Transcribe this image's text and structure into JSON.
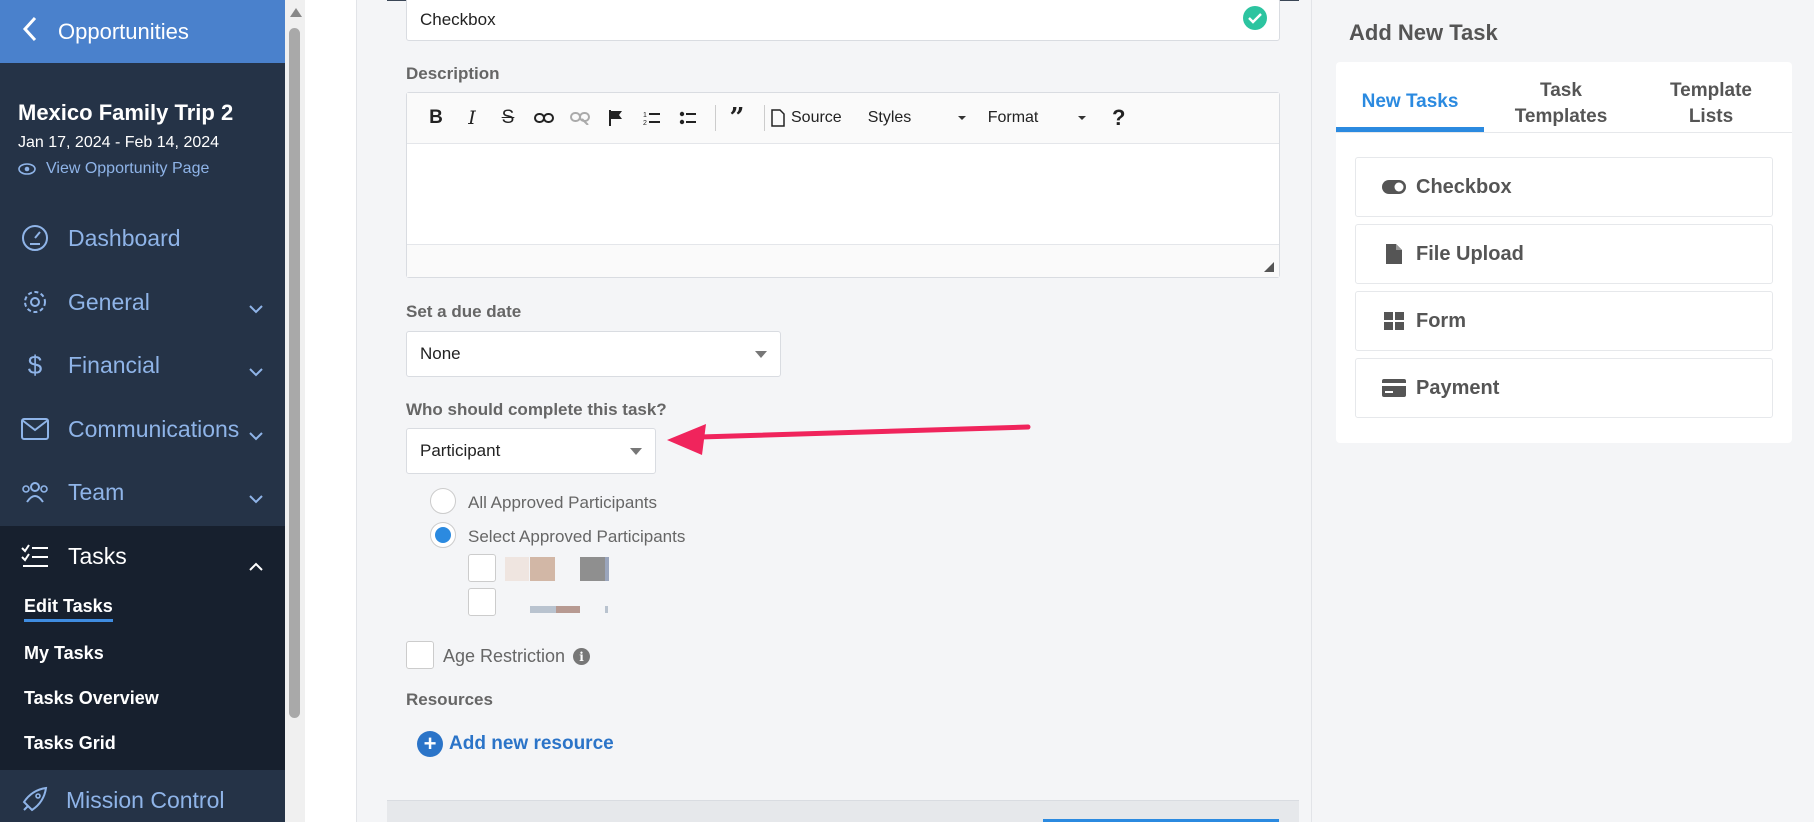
{
  "sidebar": {
    "back_label": "Opportunities",
    "trip": {
      "title": "Mexico Family Trip 2",
      "dates": "Jan 17, 2024 - Feb 14, 2024",
      "view_link": "View Opportunity Page"
    },
    "nav": [
      {
        "label": "Dashboard"
      },
      {
        "label": "General"
      },
      {
        "label": "Financial"
      },
      {
        "label": "Communications"
      },
      {
        "label": "Team"
      }
    ],
    "tasks": {
      "label": "Tasks",
      "items": [
        {
          "label": "Edit Tasks"
        },
        {
          "label": "My Tasks"
        },
        {
          "label": "Tasks Overview"
        },
        {
          "label": "Tasks Grid"
        }
      ]
    },
    "mission_control": "Mission Control"
  },
  "form": {
    "task_type_value": "Checkbox",
    "description_label": "Description",
    "toolbar": {
      "source": "Source",
      "styles": "Styles",
      "format": "Format"
    },
    "due_date_label": "Set a due date",
    "due_date_value": "None",
    "who_label": "Who should complete this task?",
    "who_value": "Participant",
    "radio_all": "All Approved Participants",
    "radio_select": "Select Approved Participants",
    "age_restriction": "Age Restriction",
    "resources_label": "Resources",
    "add_resource": "Add new resource"
  },
  "right_panel": {
    "title": "Add New Task",
    "tabs": [
      {
        "label": "New Tasks"
      },
      {
        "label": "Task Templates"
      },
      {
        "label": "Template Lists"
      }
    ],
    "options": [
      {
        "label": "Checkbox",
        "icon": "toggle-icon"
      },
      {
        "label": "File Upload",
        "icon": "file-icon"
      },
      {
        "label": "Form",
        "icon": "grid-icon"
      },
      {
        "label": "Payment",
        "icon": "credit-card-icon"
      }
    ]
  },
  "colors": {
    "sidebar_bg": "#253347",
    "sidebar_header": "#4a81cc",
    "accent": "#2b8ae0",
    "annotation_arrow": "#f0245c",
    "check_ok": "#2cc4a0"
  }
}
